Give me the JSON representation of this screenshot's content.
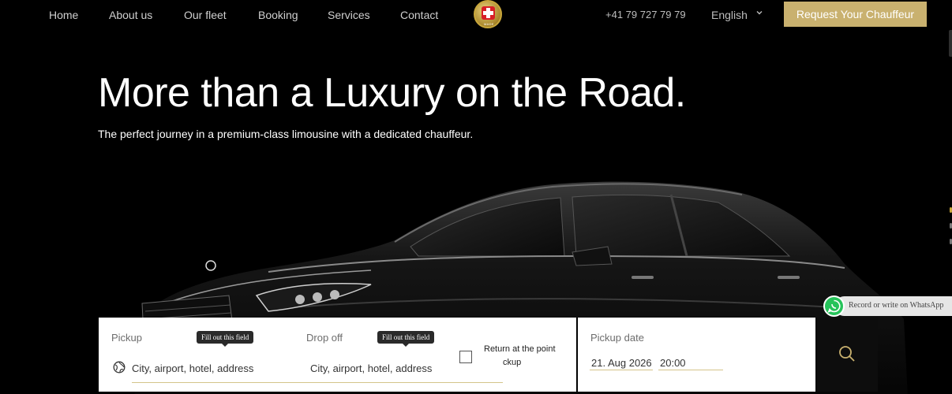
{
  "nav": {
    "links": [
      "Home",
      "About us",
      "Our fleet",
      "Booking",
      "Services",
      "Contact"
    ],
    "logo_text": "MADE",
    "phone": "+41 79 727 79 79",
    "language": "English",
    "cta": "Request Your Chauffeur"
  },
  "hero": {
    "title": "More than a Luxury on the Road.",
    "subtitle": "The perfect journey in a premium-class limousine with a dedicated chauffeur."
  },
  "whatsapp": {
    "label": "Record or write on WhatsApp"
  },
  "booking": {
    "pickup": {
      "label": "Pickup",
      "placeholder": "City, airport, hotel, address",
      "tooltip": "Fill out this field"
    },
    "dropoff": {
      "label": "Drop off",
      "placeholder": "City, airport, hotel, address",
      "tooltip": "Fill out this field"
    },
    "return_label_line1": "Return at the point",
    "return_label_line2": "ckup",
    "pickup_date": {
      "label": "Pickup date",
      "date": "21. Aug 2026",
      "time": "20:00"
    }
  },
  "colors": {
    "accent_gold": "#c9b16f",
    "background": "#000000",
    "whatsapp_green": "#26c35a"
  }
}
